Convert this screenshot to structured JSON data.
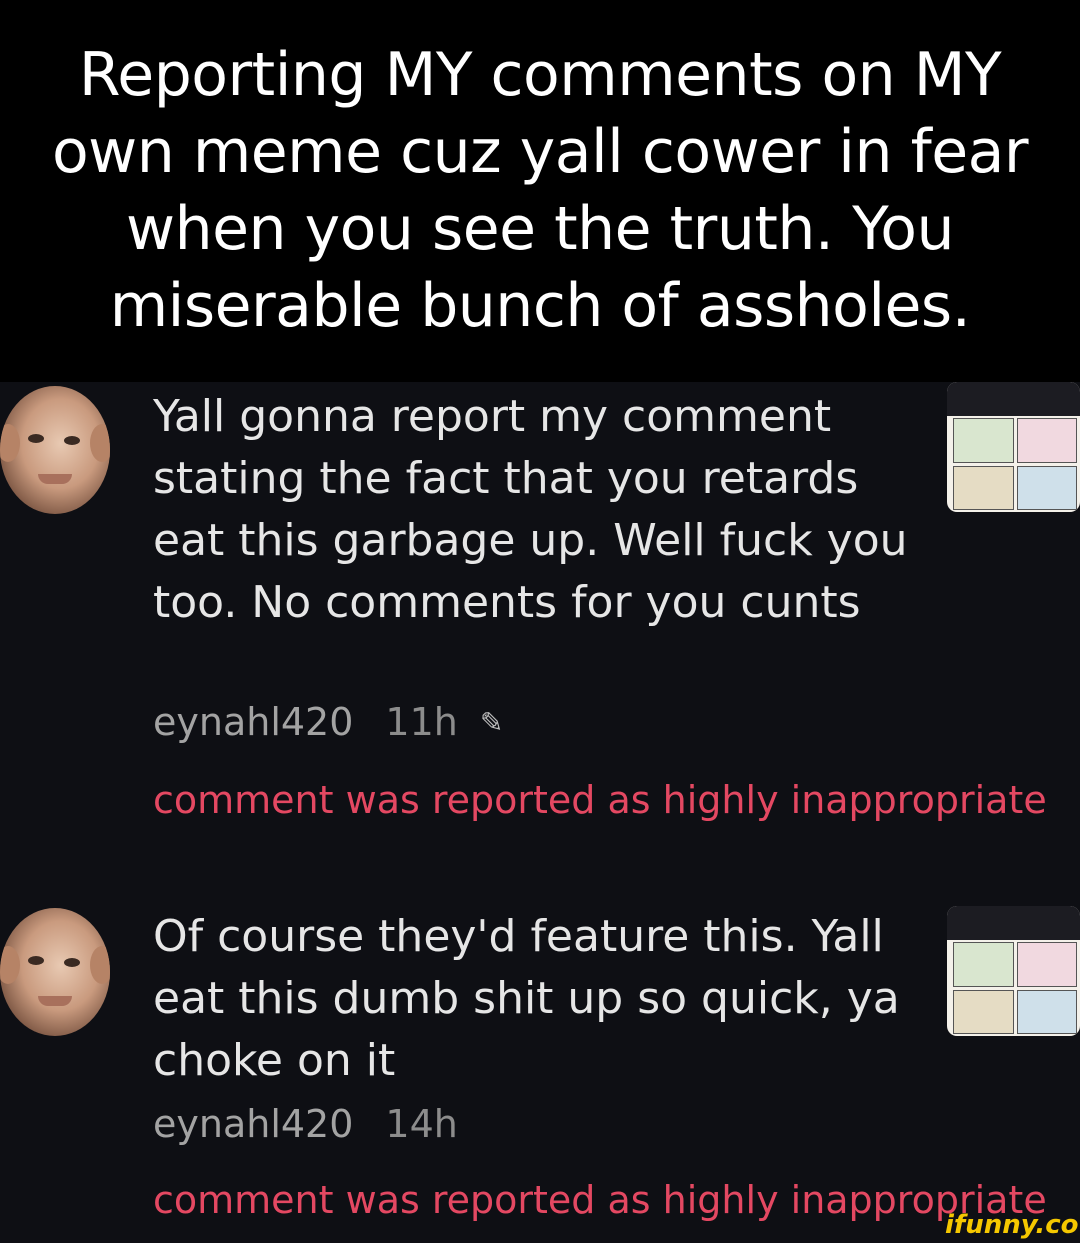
{
  "caption": "Reporting MY comments on MY own meme cuz yall cower in fear when you see the truth. You miserable bunch of assholes.",
  "comments": [
    {
      "text": "Yall gonna report my comment stating the fact that you retards eat this garbage up. Well fuck you too. No comments for you cunts",
      "username": "eynahl420",
      "time": "11h",
      "edit_icon": "pencil-icon",
      "report": "comment was reported as highly inappropriate"
    },
    {
      "text": "Of course they'd feature this. Yall eat this dumb shit up so quick, ya choke on it",
      "username": "eynahl420",
      "time": "14h",
      "report": "comment was reported as highly inappropriate"
    }
  ],
  "watermark": "ifunny.co",
  "colors": {
    "report": "#e44862",
    "background": "#0e0f14",
    "watermark": "#f5c800"
  }
}
